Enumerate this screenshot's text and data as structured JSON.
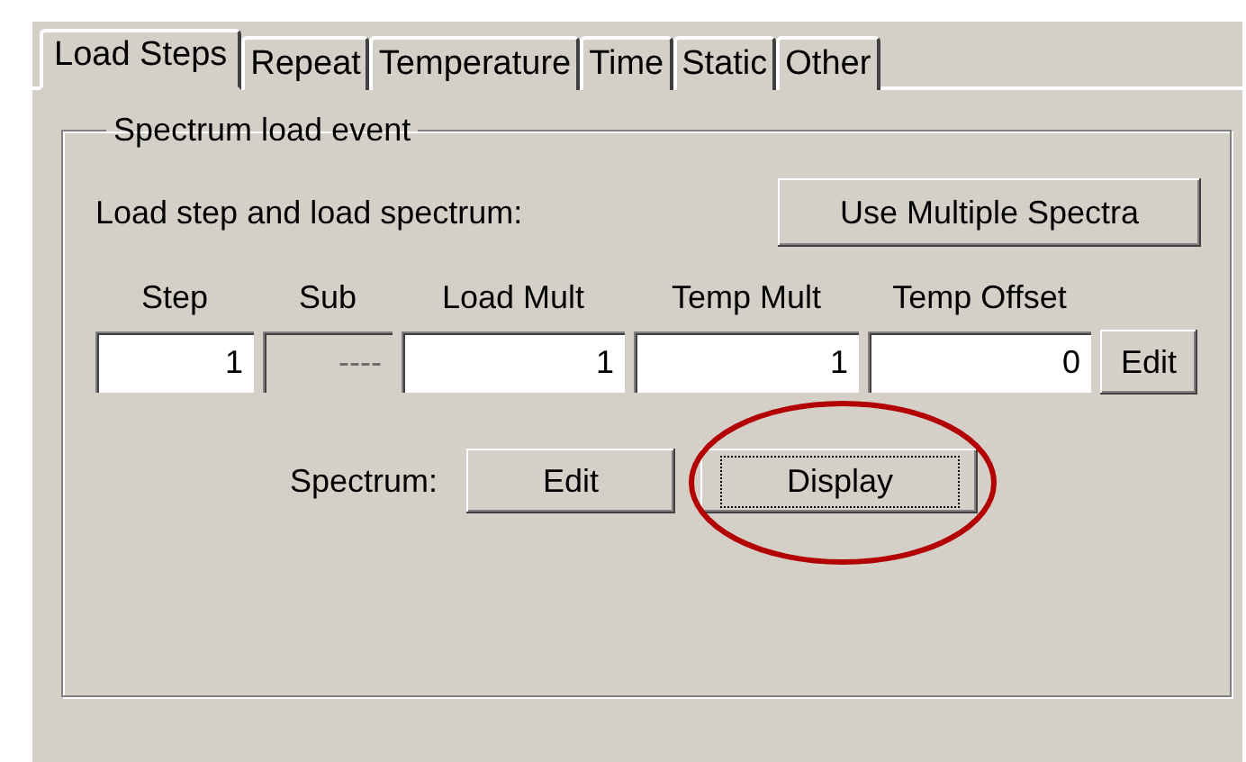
{
  "tabs": [
    {
      "label": "Load Steps",
      "selected": true
    },
    {
      "label": "Repeat",
      "selected": false
    },
    {
      "label": "Temperature",
      "selected": false
    },
    {
      "label": "Time",
      "selected": false
    },
    {
      "label": "Static",
      "selected": false
    },
    {
      "label": "Other",
      "selected": false
    }
  ],
  "group": {
    "title": "Spectrum load event",
    "prompt": "Load step and load spectrum:",
    "multiple_button": "Use Multiple Spectra",
    "fields": [
      {
        "label": "Step",
        "value": "1",
        "disabled": false
      },
      {
        "label": "Sub",
        "value": "----",
        "disabled": true
      },
      {
        "label": "Load Mult",
        "value": "1",
        "disabled": false
      },
      {
        "label": "Temp Mult",
        "value": "1",
        "disabled": false
      },
      {
        "label": "Temp Offset",
        "value": "0",
        "disabled": false
      }
    ],
    "fields_edit_button": "Edit",
    "spectrum_label": "Spectrum:",
    "spectrum_buttons": [
      {
        "label": "Edit",
        "focused": false,
        "highlighted": false
      },
      {
        "label": "Display",
        "focused": true,
        "highlighted": true
      }
    ]
  }
}
